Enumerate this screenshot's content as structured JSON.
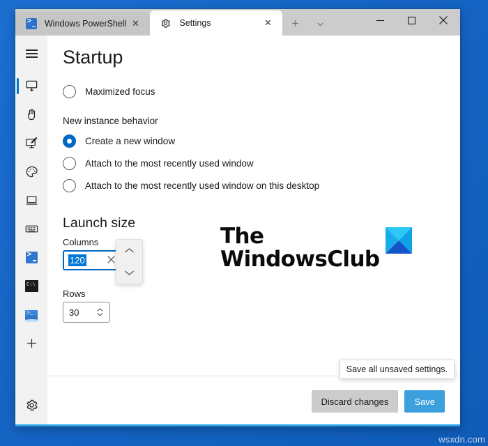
{
  "desktop": {
    "watermark": "wsxdn.com",
    "background_color": "#1565c6"
  },
  "window": {
    "tabs": [
      {
        "label": "Windows PowerShell",
        "icon": "powershell-icon",
        "active": false,
        "close_label": "✕"
      },
      {
        "label": "Settings",
        "icon": "gear-icon",
        "active": true,
        "close_label": "✕"
      }
    ],
    "new_tab_label": "+",
    "tab_dropdown_label": "⌄",
    "controls": {
      "minimize": "─",
      "maximize": "□",
      "close": "✕"
    }
  },
  "nav": {
    "menu_label": "☰",
    "items": [
      {
        "name": "startup",
        "selected": true
      },
      {
        "name": "interaction",
        "selected": false
      },
      {
        "name": "rendering",
        "selected": false
      },
      {
        "name": "color-schemes",
        "selected": false
      },
      {
        "name": "defaults",
        "selected": false
      },
      {
        "name": "actions",
        "selected": false
      },
      {
        "name": "profile-powershell",
        "selected": false
      },
      {
        "name": "profile-command-prompt",
        "selected": false
      },
      {
        "name": "profile-azure-cloud-shell",
        "selected": false
      },
      {
        "name": "add-new-profile",
        "selected": false
      }
    ],
    "add_label": "+",
    "settings_gear": "gear-icon"
  },
  "page": {
    "title": "Startup",
    "maximized_focus": {
      "label": "Maximized focus",
      "checked": false
    },
    "new_instance": {
      "group_label": "New instance behavior",
      "options": [
        {
          "label": "Create a new window",
          "checked": true
        },
        {
          "label": "Attach to the most recently used window",
          "checked": false
        },
        {
          "label": "Attach to the most recently used window on this desktop",
          "checked": false
        }
      ]
    },
    "launch_size": {
      "title": "Launch size",
      "columns": {
        "label": "Columns",
        "value": "120",
        "selected": true,
        "clear_label": "✕",
        "spinner_up": "⌃",
        "spinner_down": "⌄"
      },
      "rows": {
        "label": "Rows",
        "value": "30",
        "spinner_up": "⌃",
        "spinner_down": "⌄"
      }
    }
  },
  "watermark_logo": {
    "line1": "The",
    "line2": "WindowsClub",
    "colors": {
      "top": "#29c6f0",
      "left": "#1aa7e8",
      "right": "#12a0e8",
      "bottom": "#1358c8"
    }
  },
  "footer": {
    "discard_label": "Discard changes",
    "save_label": "Save",
    "tooltip": "Save all unsaved settings.",
    "save_color": "#3ba0dd"
  }
}
